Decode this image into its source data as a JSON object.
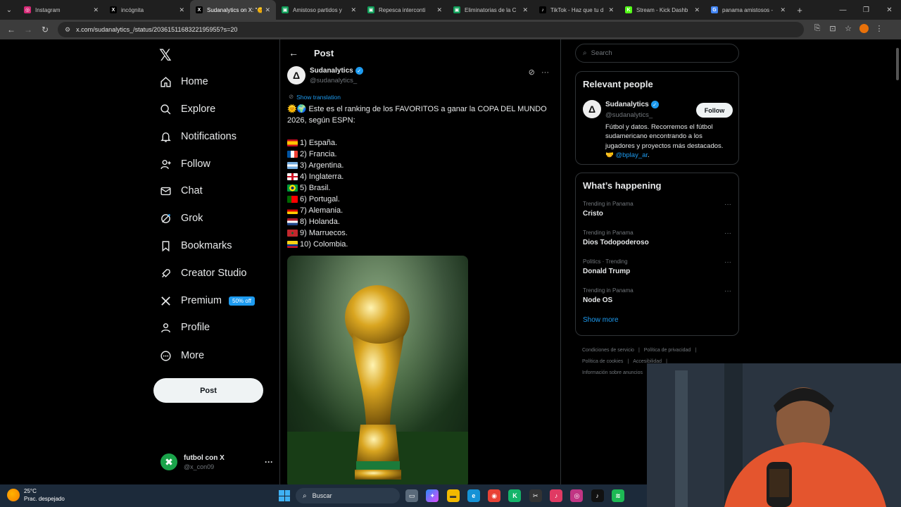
{
  "browser": {
    "tabs": [
      {
        "label": "Instagram",
        "color": "#d62976",
        "glyph": "◎",
        "active": false
      },
      {
        "label": "incógnita",
        "color": "#000000",
        "glyph": "X",
        "active": false
      },
      {
        "label": "Sudanalytics on X: \"🌞",
        "color": "#000000",
        "glyph": "X",
        "active": true
      },
      {
        "label": "Amistoso partidos y",
        "color": "#0f9d58",
        "glyph": "▣",
        "active": false
      },
      {
        "label": "Repesca interconti",
        "color": "#0f9d58",
        "glyph": "▣",
        "active": false
      },
      {
        "label": "Eliminatorias de la C",
        "color": "#0f9d58",
        "glyph": "▣",
        "active": false
      },
      {
        "label": "TikTok - Haz que tu d",
        "color": "#000000",
        "glyph": "♪",
        "active": false
      },
      {
        "label": "Stream - Kick Dashb",
        "color": "#53fc18",
        "glyph": "K",
        "active": false
      },
      {
        "label": "panama amistosos -",
        "color": "#4285f4",
        "glyph": "G",
        "active": false
      }
    ],
    "url": "x.com/sudanalytics_/status/2036151168322195955?s=20"
  },
  "nav": {
    "items": [
      {
        "label": "Home",
        "icon": "home-icon"
      },
      {
        "label": "Explore",
        "icon": "search-icon"
      },
      {
        "label": "Notifications",
        "icon": "bell-icon"
      },
      {
        "label": "Follow",
        "icon": "person-plus-icon"
      },
      {
        "label": "Chat",
        "icon": "mail-icon"
      },
      {
        "label": "Grok",
        "icon": "grok-icon"
      },
      {
        "label": "Bookmarks",
        "icon": "bookmark-icon"
      },
      {
        "label": "Creator Studio",
        "icon": "rocket-icon"
      },
      {
        "label": "Premium",
        "icon": "x-icon"
      },
      {
        "label": "Profile",
        "icon": "person-icon"
      },
      {
        "label": "More",
        "icon": "more-circle-icon"
      }
    ],
    "premium_badge": "50% off",
    "post_button": "Post",
    "account_name": "futbol con X",
    "account_handle": "@x_con09"
  },
  "post": {
    "header_title": "Post",
    "author_name": "Sudanalytics",
    "author_handle": "@sudanalytics_",
    "show_translation": "Show translation",
    "text": "🌞🌍 Este es el ranking de los FAVORITOS a ganar la COPA DEL MUNDO 2026, según ESPN:",
    "ranking": [
      {
        "text": "1) España.",
        "flag": "spain"
      },
      {
        "text": "2) Francia.",
        "flag": "france"
      },
      {
        "text": "3) Argentina.",
        "flag": "argentina"
      },
      {
        "text": "4) Inglaterra.",
        "flag": "england"
      },
      {
        "text": "5) Brasil.",
        "flag": "brazil"
      },
      {
        "text": "6) Portugal.",
        "flag": "portugal"
      },
      {
        "text": "7) Alemania.",
        "flag": "germany"
      },
      {
        "text": "8) Holanda.",
        "flag": "netherlands"
      },
      {
        "text": "9) Marruecos.",
        "flag": "morocco"
      },
      {
        "text": "10) Colombia.",
        "flag": "colombia"
      }
    ]
  },
  "sidebar": {
    "search_placeholder": "Search",
    "relevant_title": "Relevant people",
    "person": {
      "name": "Sudanalytics",
      "handle": "@sudanalytics_",
      "follow_label": "Follow",
      "bio": "Fútbol y datos. Recorremos el fútbol sudamericano encontrando a los jugadores y proyectos más destacados. 🤝 ",
      "bio_link": "@bplay_ar",
      "bio_end": "."
    },
    "happening_title": "What’s happening",
    "trends": [
      {
        "meta": "Trending in Panama",
        "name": "Cristo"
      },
      {
        "meta": "Trending in Panama",
        "name": "Dios Todopoderoso"
      },
      {
        "meta": "Politics · Trending",
        "name": "Donald Trump"
      },
      {
        "meta": "Trending in Panama",
        "name": "Node OS"
      }
    ],
    "show_more": "Show more",
    "footer": [
      "Condiciones de servicio",
      "|",
      "Política de privacidad",
      "|",
      "Política de cookies",
      "|",
      "Accesibilidad",
      "|",
      "Información sobre anuncios"
    ]
  },
  "taskbar": {
    "temperature": "25°C",
    "weather_text": "Prac. despejado",
    "search_label": "Buscar"
  },
  "colors": {
    "accent": "#1d9bf0",
    "background": "#000000",
    "border": "#2f3336"
  }
}
